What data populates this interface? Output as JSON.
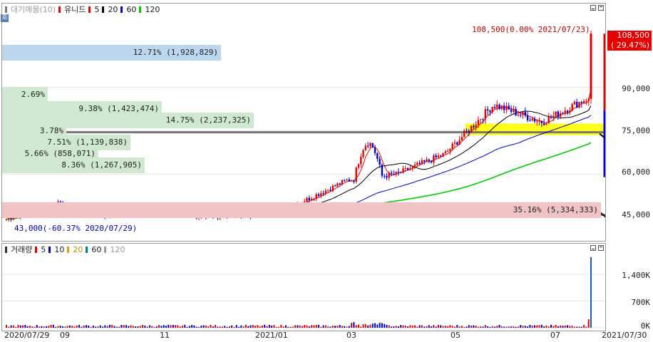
{
  "price_legend": {
    "icon": "bar-chart-icon",
    "title": "대기매물(10)",
    "items": [
      {
        "label": "유니드",
        "color": "#e60000"
      },
      {
        "label": "5",
        "color": "#e60000"
      },
      {
        "label": "20",
        "color": "#000000"
      },
      {
        "label": "60",
        "color": "#0000cc"
      },
      {
        "label": "120",
        "color": "#00cc00"
      }
    ]
  },
  "volume_legend": {
    "title": "거래량",
    "items": [
      {
        "label": "5",
        "color": "#e60000"
      },
      {
        "label": "10",
        "color": "#0000cc"
      },
      {
        "label": "20",
        "color": "#e8a000"
      },
      {
        "label": "60",
        "color": "#008080"
      },
      {
        "label": "120",
        "color": "#999999"
      }
    ]
  },
  "volume_profile": [
    {
      "label": "12.71% (1,928,829)",
      "color": "#bcd6ee"
    },
    {
      "label": "2.69% (407,882)",
      "color": "#cfe8cf"
    },
    {
      "label": "9.38% (1,423,474)",
      "color": "#cfe8cf"
    },
    {
      "label": "14.75% (2,237,325)",
      "color": "#cfe8cf"
    },
    {
      "label": "3.78% (573,787)",
      "color": "#cfe8cf"
    },
    {
      "label": "7.51% (1,139,838)",
      "color": "#cfe8cf"
    },
    {
      "label": "5.66% (858,071)",
      "color": "#cfe8cf"
    },
    {
      "label": "8.36% (1,267,905)",
      "color": "#cfe8cf"
    },
    {
      "label": "35.16% (5,334,333)",
      "color": "#f0c4c4"
    }
  ],
  "annotations": {
    "high": "108,500(0.00% 2021/07/23)",
    "low": "43,000(-60.37% 2020/07/29)"
  },
  "current_price": {
    "value": "108,500",
    "change": "( 29.47%)",
    "color": "#e60000"
  },
  "corner_icon": "호",
  "price_axis": [
    "90,000",
    "75,000",
    "60,000",
    "45,000"
  ],
  "volume_axis": [
    "1,400K",
    "700K",
    "0K"
  ],
  "x_axis": [
    "2020/07/29",
    "09",
    "11",
    "2021/01",
    "03",
    "05",
    "07",
    "2021/07/30"
  ],
  "chart_data": {
    "type": "candlestick",
    "title": "유니드",
    "period": [
      "2020/07/29",
      "2021/07/30"
    ],
    "ylim": [
      40000,
      112000
    ],
    "y_ticks": [
      45000,
      60000,
      75000,
      90000
    ],
    "volume_ylim": [
      0,
      1900000
    ],
    "volume_ticks": [
      0,
      700000,
      1400000
    ],
    "x": [
      "2020/07/29",
      "2020/08",
      "2020/09",
      "2020/10",
      "2020/11",
      "2020/12",
      "2021/01",
      "2021/02",
      "2021/03",
      "2021/04",
      "2021/05",
      "2021/06",
      "2021/07"
    ],
    "close": [
      44500,
      50000,
      46000,
      47000,
      45500,
      46000,
      50000,
      58000,
      60000,
      67000,
      84000,
      78000,
      87000
    ],
    "last_close": 108500,
    "max_price": 108500,
    "min_price": 43000,
    "support_lines": [
      74500,
      46000
    ],
    "ma120_end": 73000,
    "volume_spike": 1850000
  }
}
